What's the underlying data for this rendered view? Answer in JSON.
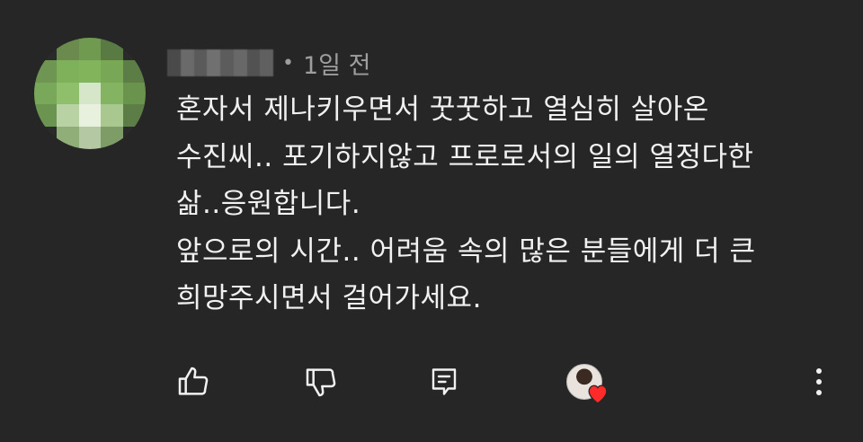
{
  "comment": {
    "author_avatar_blurred": true,
    "author_name_blurred": true,
    "dot": "•",
    "time": "1일 전",
    "text": "혼자서 제나키우면서 꿋꿋하고 열심히 살아온\n수진씨.. 포기하지않고 프로로서의 일의 열정다한\n삶..응원합니다.\n앞으로의 시간.. 어려움 속의 많은 분들에게 더 큰\n희망주시면서 걸어가세요."
  },
  "actions": {
    "like_icon": "thumbs-up-icon",
    "dislike_icon": "thumbs-down-icon",
    "reply_icon": "reply-icon",
    "creator_heart_icon": "creator-heart-icon",
    "more_icon": "more-vert-icon"
  },
  "colors": {
    "background": "#262626",
    "text": "#f1f1f1",
    "meta": "#9e9e9e",
    "heart": "#ff2a2a"
  }
}
